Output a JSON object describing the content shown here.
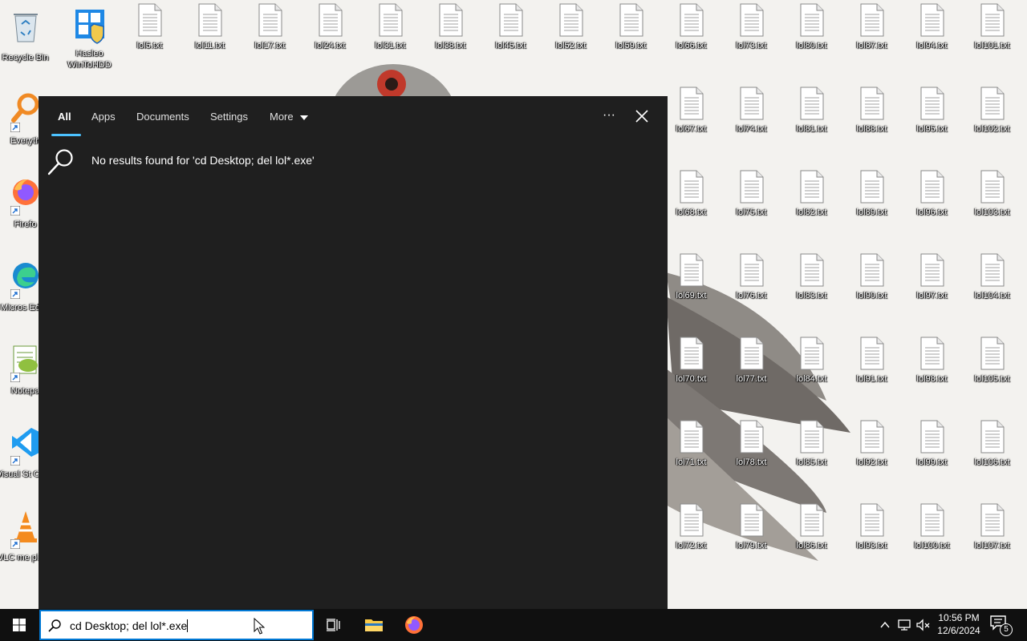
{
  "desktop": {
    "left_icons": [
      {
        "name": "recycle-bin",
        "label": "Recycle Bin",
        "kind": "recycle"
      },
      {
        "name": "everything",
        "label": "Everyth",
        "kind": "search"
      },
      {
        "name": "firefox",
        "label": "Firefo",
        "kind": "firefox"
      },
      {
        "name": "edge",
        "label": "Micros Edge",
        "kind": "edge"
      },
      {
        "name": "notepad",
        "label": "Notepa",
        "kind": "notepad"
      },
      {
        "name": "vscode",
        "label": "Visual St Code",
        "kind": "vscode"
      },
      {
        "name": "vlc",
        "label": "VLC me playe",
        "kind": "vlc"
      }
    ],
    "hasleo_icon": {
      "label": "Hasleo WinToHDD"
    },
    "file_columns": [
      {
        "items": [
          "lol5.txt"
        ]
      },
      {
        "items": [
          "lol11.txt"
        ]
      },
      {
        "items": [
          "lol17.txt"
        ]
      },
      {
        "items": [
          "lol24.txt"
        ]
      },
      {
        "items": [
          "lol31.txt"
        ]
      },
      {
        "items": [
          "lol38.txt"
        ]
      },
      {
        "items": [
          "lol45.txt"
        ]
      },
      {
        "items": [
          "lol52.txt"
        ]
      },
      {
        "items": [
          "lol59.txt"
        ]
      },
      {
        "items": [
          "lol66.txt",
          "lol67.txt",
          "lol68.txt",
          "lol69.txt",
          "lol70.txt",
          "lol71.txt",
          "lol72.txt"
        ]
      },
      {
        "items": [
          "lol73.txt",
          "lol74.txt",
          "lol75.txt",
          "lol76.txt",
          "lol77.txt",
          "lol78.txt",
          "lol79.txt"
        ]
      },
      {
        "items": [
          "lol80.txt",
          "lol81.txt",
          "lol82.txt",
          "lol83.txt",
          "lol84.txt",
          "lol85.txt",
          "lol86.txt"
        ]
      },
      {
        "items": [
          "lol87.txt",
          "lol88.txt",
          "lol89.txt",
          "lol90.txt",
          "lol91.txt",
          "lol92.txt",
          "lol93.txt"
        ]
      },
      {
        "items": [
          "lol94.txt",
          "lol95.txt",
          "lol96.txt",
          "lol97.txt",
          "lol98.txt",
          "lol99.txt",
          "lol100.txt"
        ]
      },
      {
        "items": [
          "lol101.txt",
          "lol102.txt",
          "lol103.txt",
          "lol104.txt",
          "lol105.txt",
          "lol106.txt",
          "lol107.txt"
        ]
      }
    ]
  },
  "search_panel": {
    "tabs": [
      {
        "label": "All",
        "active": true
      },
      {
        "label": "Apps",
        "active": false
      },
      {
        "label": "Documents",
        "active": false
      },
      {
        "label": "Settings",
        "active": false
      },
      {
        "label": "More",
        "active": false
      }
    ],
    "dots": "···",
    "no_results": "No results found for 'cd Desktop; del lol*.exe'"
  },
  "taskbar": {
    "search_text": "cd Desktop; del lol*.exe",
    "apps": [
      {
        "name": "task-view",
        "icon": "task-view-icon"
      },
      {
        "name": "file-explorer",
        "icon": "folder-icon"
      },
      {
        "name": "firefox",
        "icon": "firefox-icon"
      }
    ],
    "clock_time": "10:56 PM",
    "clock_date": "12/6/2024",
    "notification_count": "5"
  },
  "colors": {
    "panel_bg": "#1f1f1f",
    "accent": "#4cc2ff",
    "taskbar_bg": "#101010",
    "search_border": "#0078d4"
  }
}
